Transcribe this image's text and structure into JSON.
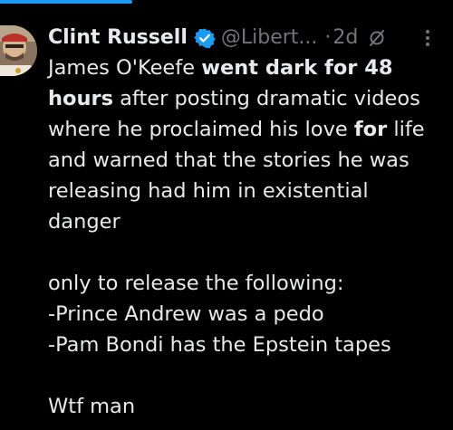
{
  "colors": {
    "background": "#000000",
    "text": "#e7e9ea",
    "muted": "#71767b",
    "accent": "#1d9bf0"
  },
  "tweet": {
    "author": {
      "display_name": "Clint Russell",
      "handle": "@Libert...",
      "verified": true
    },
    "separator": "·",
    "timestamp": "2d",
    "icons": {
      "verified": "verified-badge-icon",
      "grok": "grok-icon",
      "more": "more-options-icon"
    },
    "body": {
      "line1_a": "James O'Keefe ",
      "line1_b": "went dark for 48",
      "line2_a": "hours",
      "line2_b": " after posting dramatic videos",
      "line3_a": "where he proclaimed his love ",
      "line3_b": "for",
      "line3_c": " life",
      "line4": "and warned that the stories he was",
      "line5": "releasing had him in existential",
      "line6": "danger",
      "line7": "only to release the following:",
      "line8": "-Prince Andrew was a pedo",
      "line9": "-Pam Bondi has the Epstein tapes",
      "line10": "Wtf man"
    }
  }
}
